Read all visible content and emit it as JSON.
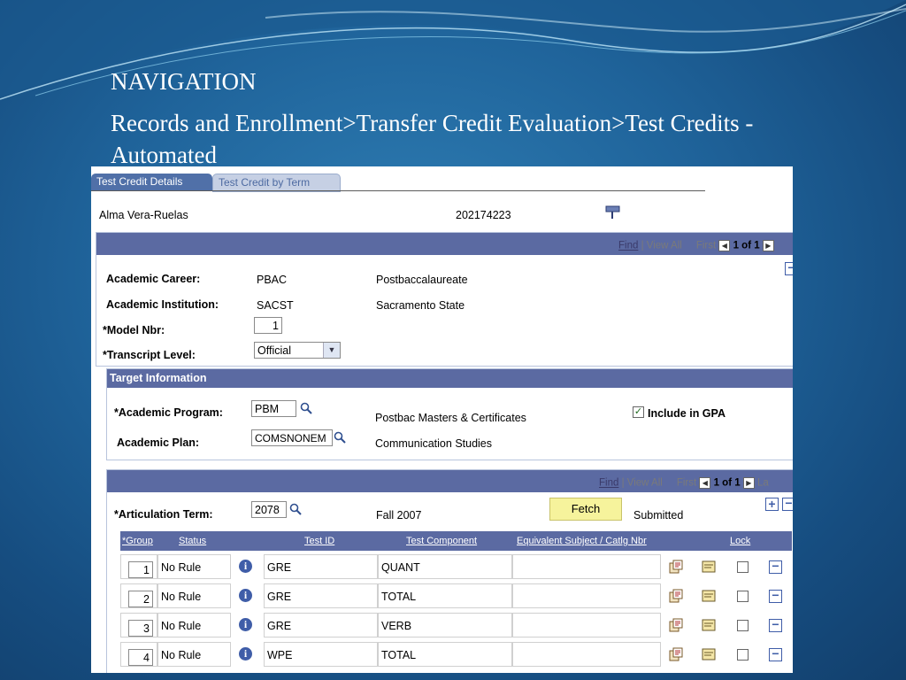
{
  "slide": {
    "title": "NAVIGATION",
    "subtitle": "Records and Enrollment>Transfer Credit Evaluation>Test Credits - Automated"
  },
  "tabs": [
    {
      "label": "Test Credit Details",
      "active": true
    },
    {
      "label": "Test Credit by Term",
      "active": false
    }
  ],
  "header": {
    "name": "Alma Vera-Ruelas",
    "id": "202174223"
  },
  "nav_top": {
    "find": "Find",
    "view_all": "View All",
    "first": "First",
    "count": "1 of 1"
  },
  "career": {
    "career_label": "Academic Career:",
    "career_code": "PBAC",
    "career_desc": "Postbaccalaureate",
    "institution_label": "Academic Institution:",
    "institution_code": "SACST",
    "institution_desc": "Sacramento State",
    "model_label": "*Model Nbr:",
    "model_value": "1",
    "transcript_label": "*Transcript Level:",
    "transcript_value": "Official"
  },
  "target": {
    "heading": "Target Information",
    "program_label": "*Academic Program:",
    "program_value": "PBM",
    "program_desc": "Postbac Masters & Certificates",
    "include_gpa_label": "Include in GPA",
    "include_gpa": true,
    "plan_label": "Academic Plan:",
    "plan_value": "COMSNONEM",
    "plan_desc": "Communication Studies"
  },
  "nav_bottom": {
    "find": "Find",
    "view_all": "View All",
    "first": "First",
    "count": "1 of 1",
    "last": "La"
  },
  "articulation": {
    "term_label": "*Articulation Term:",
    "term_value": "2078",
    "term_desc": "Fall 2007",
    "fetch_label": "Fetch",
    "status": "Submitted"
  },
  "grid": {
    "headers": {
      "group": "*Group",
      "status": "Status",
      "test_id": "Test ID",
      "component": "Test Component",
      "equivalent": "Equivalent Subject / Catlg Nbr",
      "lock": "Lock"
    },
    "rows": [
      {
        "group": "1",
        "status": "No Rule",
        "test_id": "GRE",
        "component": "QUANT"
      },
      {
        "group": "2",
        "status": "No Rule",
        "test_id": "GRE",
        "component": "TOTAL"
      },
      {
        "group": "3",
        "status": "No Rule",
        "test_id": "GRE",
        "component": "VERB"
      },
      {
        "group": "4",
        "status": "No Rule",
        "test_id": "WPE",
        "component": "TOTAL"
      }
    ]
  }
}
